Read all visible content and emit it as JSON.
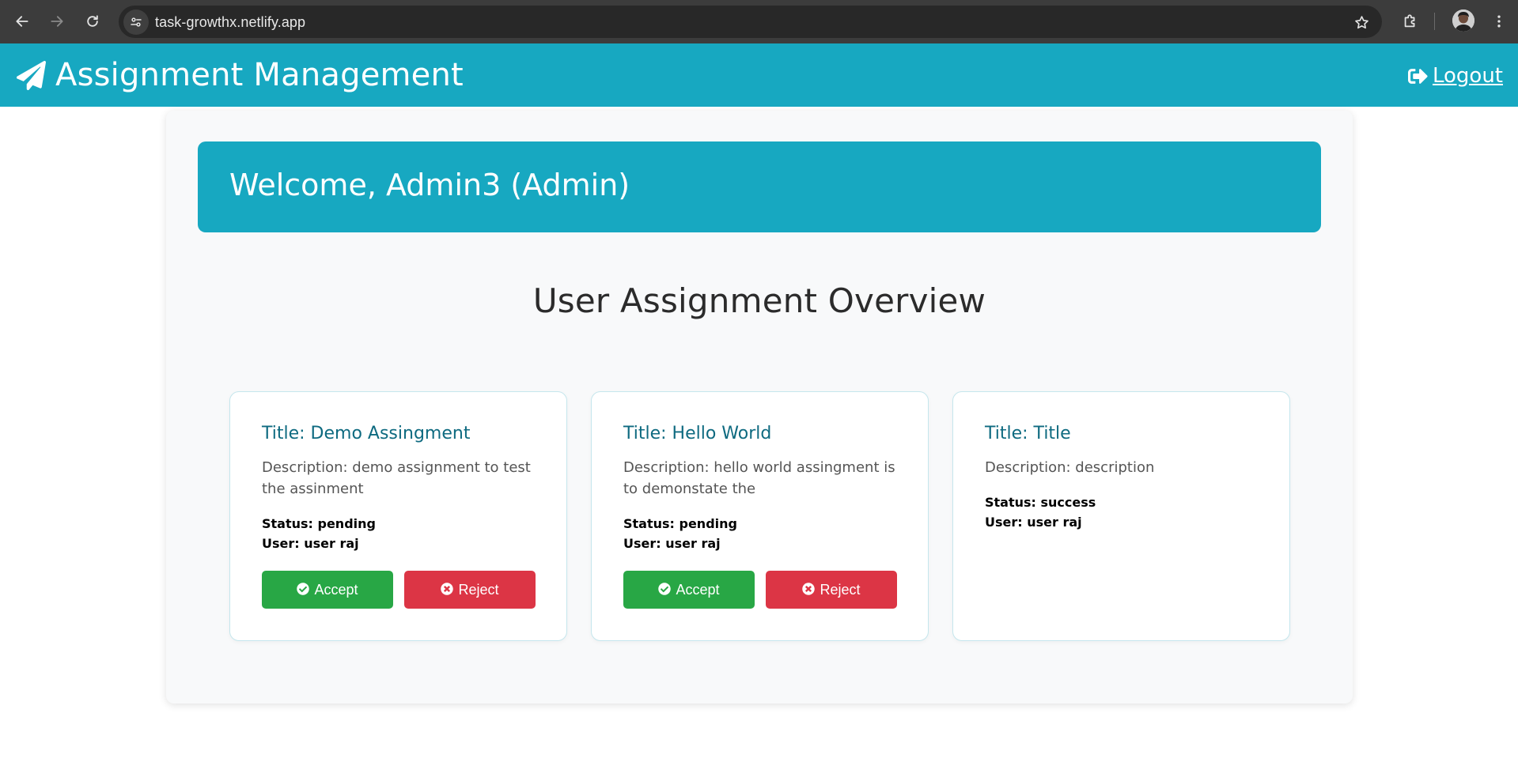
{
  "browser": {
    "url": "task-growthx.netlify.app",
    "icons": {
      "back": "arrow-left-icon",
      "forward": "arrow-right-icon",
      "reload": "reload-icon",
      "site_info": "tune-icon",
      "bookmark": "star-icon",
      "extensions": "puzzle-icon",
      "menu": "kebab-menu-icon"
    }
  },
  "header": {
    "brand_icon": "paper-plane-icon",
    "title": "Assignment Management",
    "logout_label": "Logout",
    "logout_icon": "sign-out-icon",
    "background_color": "#17a8c1"
  },
  "welcome": {
    "text": "Welcome, Admin3 (Admin)"
  },
  "overview": {
    "title": "User Assignment Overview"
  },
  "assignments": [
    {
      "title": "Title: Demo Assingment",
      "description": "Description: demo assignment to test the assinment",
      "status": "Status: pending",
      "user": "User: user raj",
      "accept_label": "Accept",
      "reject_label": "Reject"
    },
    {
      "title": "Title: Hello World",
      "description": "Description: hello world assingment is to demonstate the",
      "status": "Status: pending",
      "user": "User: user raj",
      "accept_label": "Accept",
      "reject_label": "Reject"
    },
    {
      "title": "Title: Title",
      "description": "Description: description",
      "status": "Status: success",
      "user": "User: user raj"
    }
  ],
  "colors": {
    "accent": "#17a8c1",
    "accept": "#28a745",
    "reject": "#dc3545",
    "card_title": "#0e6a80"
  }
}
